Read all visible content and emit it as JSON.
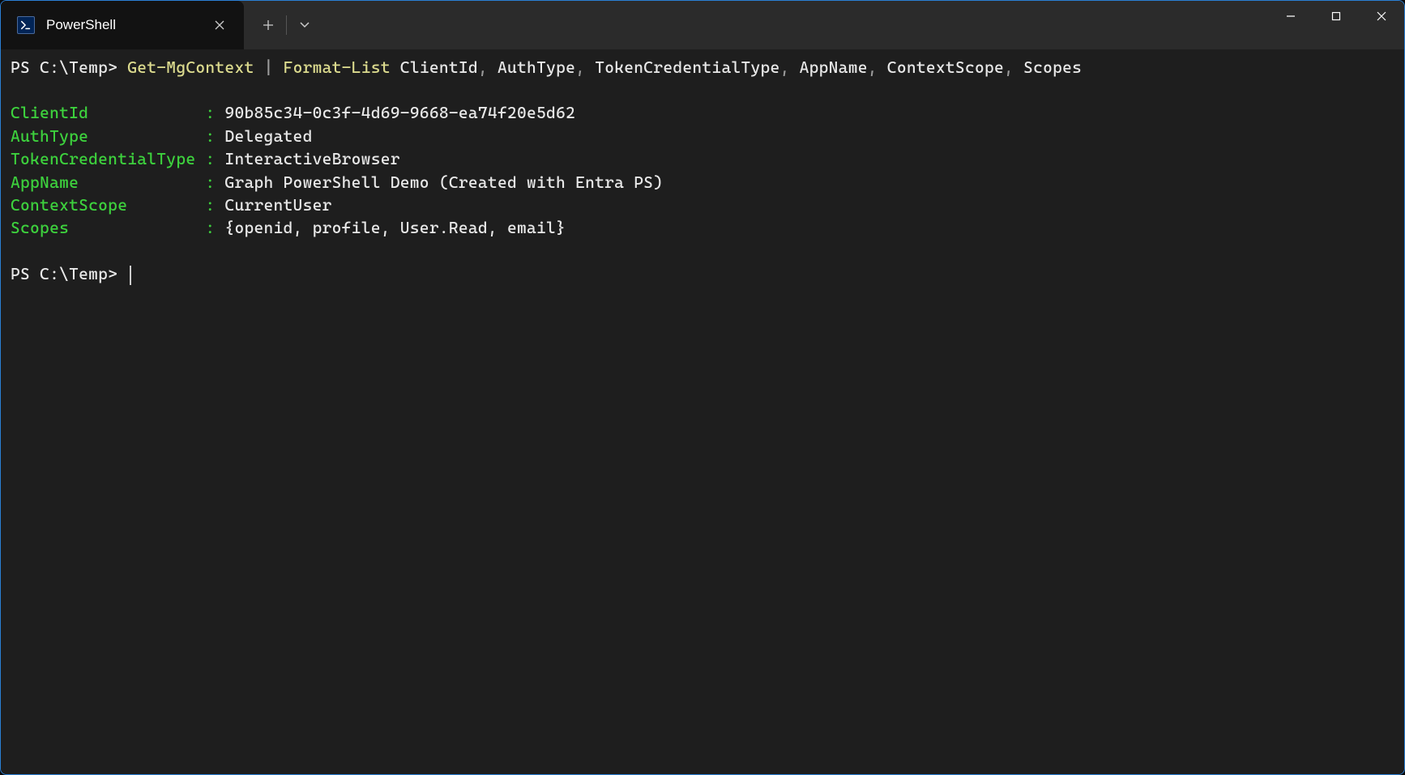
{
  "tab": {
    "title": "PowerShell"
  },
  "terminal": {
    "prompt": "PS C:\\Temp> ",
    "command": {
      "cmd1": "Get-MgContext",
      "pipe": " | ",
      "cmd2": "Format-List",
      "args_prefix": " ",
      "args": "ClientId, AuthType, TokenCredentialType, AppName, ContextScope, Scopes"
    },
    "output": [
      {
        "name": "ClientId",
        "value": "90b85c34-0c3f-4d69-9668-ea74f20e5d62"
      },
      {
        "name": "AuthType",
        "value": "Delegated"
      },
      {
        "name": "TokenCredentialType",
        "value": "InteractiveBrowser"
      },
      {
        "name": "AppName",
        "value": "Graph PowerShell Demo (Created with Entra PS)"
      },
      {
        "name": "ContextScope",
        "value": "CurrentUser"
      },
      {
        "name": "Scopes",
        "value": "{openid, profile, User.Read, email}"
      }
    ],
    "prompt2": "PS C:\\Temp> ",
    "label_width": 19
  }
}
